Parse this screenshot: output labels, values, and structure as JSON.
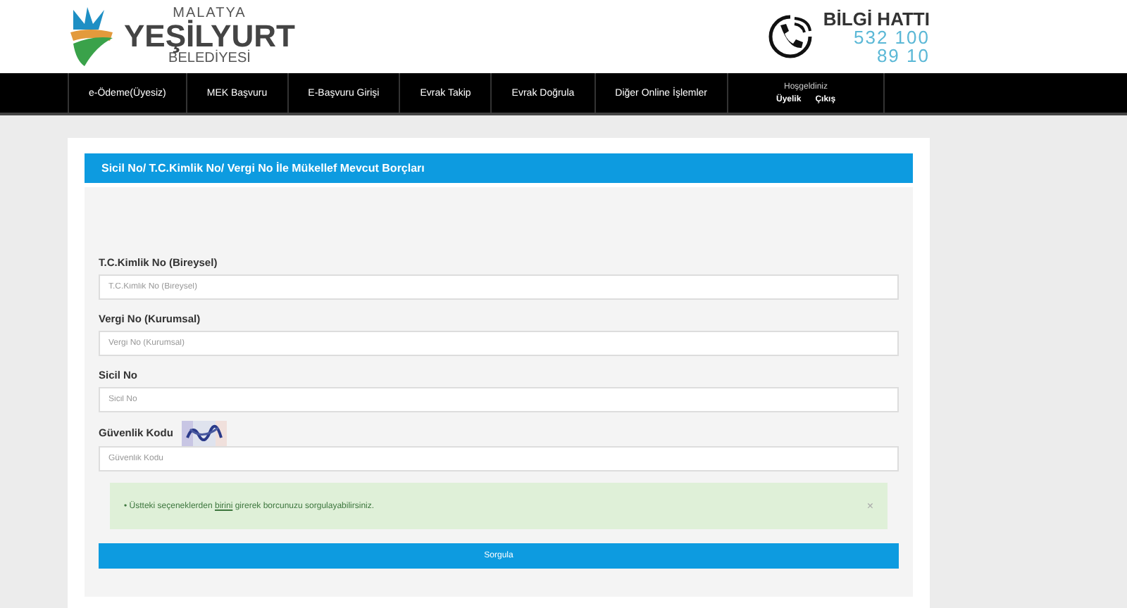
{
  "logo": {
    "top": "MALATYA",
    "main": "YEŞİLYURT",
    "bottom": "BELEDİYESİ"
  },
  "hotline": {
    "title": "BİLGİ HATTI",
    "number_lines": [
      "532 100",
      "89 10"
    ]
  },
  "nav": {
    "items": [
      "e-Ödeme(Üyesiz)",
      "MEK Başvuru",
      "E-Başvuru Girişi",
      "Evrak Takip",
      "Evrak Doğrula",
      "Diğer Online İşlemler"
    ],
    "welcome": {
      "greeting": "Hoşgeldiniz",
      "links": [
        "Üyelik",
        "Çıkış"
      ]
    }
  },
  "form": {
    "title": "Sicil No/ T.C.Kimlik No/ Vergi No İle Mükellef Mevcut Borçları",
    "fields": [
      {
        "label": "T.C.Kimlik No (Bireysel)",
        "placeholder": "T.C.Kimlik No (Bireysel)",
        "captcha": false
      },
      {
        "label": "Vergi No (Kurumsal)",
        "placeholder": "Vergi No (Kurumsal)",
        "captcha": false
      },
      {
        "label": "Sicil No",
        "placeholder": "Sicil No",
        "captcha": false
      },
      {
        "label": "Güvenlik Kodu",
        "placeholder": "Güvenlik Kodu",
        "captcha": true
      }
    ],
    "alert": {
      "bullet": "•",
      "before": "Üstteki seçeneklerden ",
      "link": "birini",
      "after": " girerek borcunuzu sorgulayabilirsiniz.",
      "close": "×"
    },
    "submit": "Sorgula"
  }
}
